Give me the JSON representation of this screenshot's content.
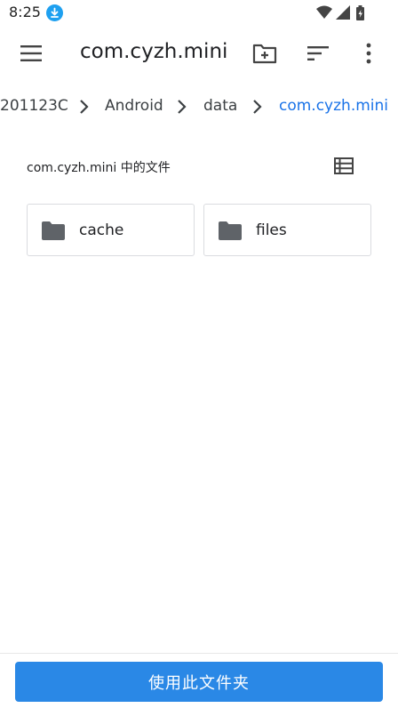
{
  "status_bar": {
    "time": "8:25",
    "icons": [
      "download-icon",
      "wifi-icon",
      "signal-icon",
      "battery-icon"
    ]
  },
  "app_bar": {
    "title": "com.cyzh.mini",
    "icons": [
      "menu-icon",
      "new-folder-icon",
      "sort-icon",
      "more-vert-icon"
    ]
  },
  "breadcrumb": {
    "items": [
      "201123C",
      "Android",
      "data",
      "com.cyzh.mini"
    ]
  },
  "section": {
    "title": "com.cyzh.mini 中的文件"
  },
  "folders": [
    {
      "name": "cache"
    },
    {
      "name": "files"
    }
  ],
  "bottom": {
    "use_folder_label": "使用此文件夹"
  },
  "colors": {
    "accent": "#1a73e8",
    "button": "#2a88e6",
    "icon": "#5f6368"
  }
}
